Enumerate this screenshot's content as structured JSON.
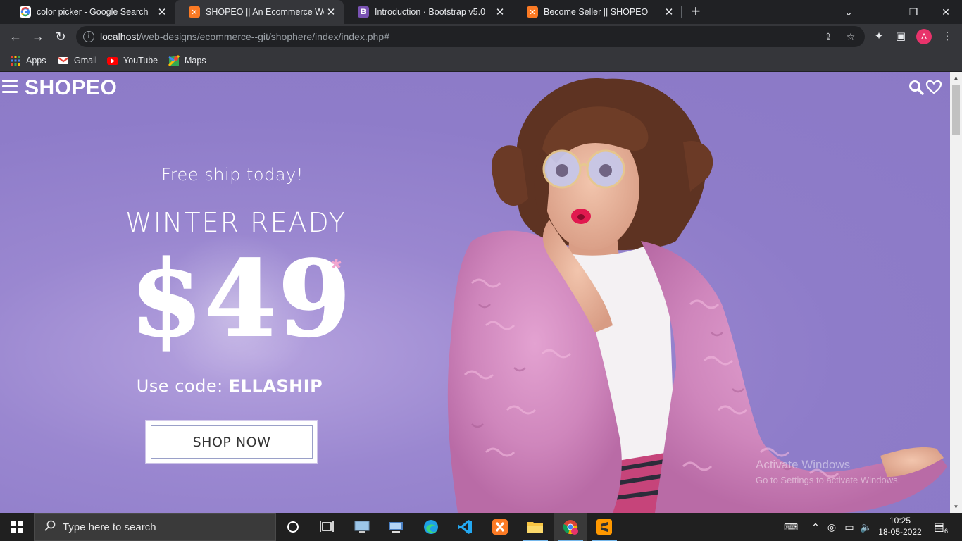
{
  "browser": {
    "tabs": [
      {
        "title": "color picker - Google Search",
        "favicon": "google-icon",
        "active": false
      },
      {
        "title": "SHOPEO || An Ecommerce Websi",
        "favicon": "xampp-icon",
        "active": true
      },
      {
        "title": "Introduction · Bootstrap v5.0",
        "favicon": "bootstrap-icon",
        "active": false
      },
      {
        "title": "Become Seller || SHOPEO",
        "favicon": "xampp-icon",
        "active": false
      }
    ],
    "new_tab": "+",
    "url_host": "localhost",
    "url_path": "/web-designs/ecommerce--git/shophere/index/index.php#",
    "profile_initial": "A",
    "bookmarks": [
      {
        "label": "Apps",
        "icon": "apps-grid-icon"
      },
      {
        "label": "Gmail",
        "icon": "gmail-icon"
      },
      {
        "label": "YouTube",
        "icon": "youtube-icon"
      },
      {
        "label": "Maps",
        "icon": "maps-icon"
      }
    ]
  },
  "site": {
    "brand": "SHOPEO",
    "hero": {
      "free_ship": "Free ship today!",
      "title": "WINTER READY",
      "price": "$49",
      "asterisk": "*",
      "code_prefix": "Use code: ",
      "code": "ELLASHIP",
      "cta": "SHOP NOW"
    }
  },
  "watermark": {
    "line1": "Activate Windows",
    "line2": "Go to Settings to activate Windows."
  },
  "taskbar": {
    "search_placeholder": "Type here to search",
    "time": "10:25",
    "date": "18-05-2022",
    "notification_count": "6"
  },
  "colors": {
    "hero_bg": "#8e7cc9",
    "jacket": "#d58fc3",
    "chrome_dark": "#202124",
    "chrome_toolbar": "#35363a"
  }
}
